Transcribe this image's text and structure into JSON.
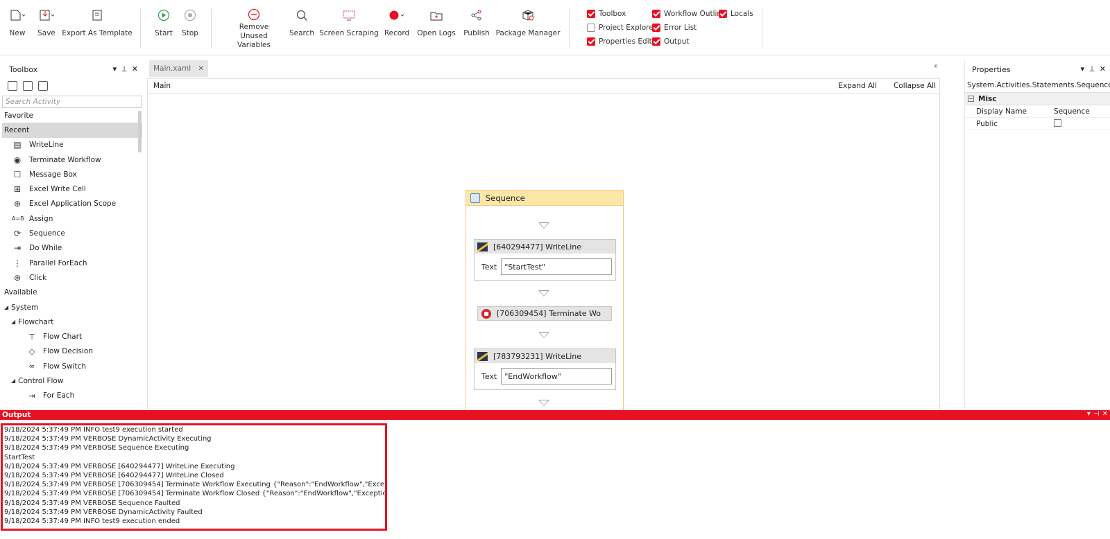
{
  "ribbon": {
    "buttons": [
      {
        "label": "New"
      },
      {
        "label": "Save"
      },
      {
        "label": "Export As Template"
      },
      {
        "label": "Start"
      },
      {
        "label": "Stop"
      },
      {
        "label": "Remove Unused\nVariables"
      },
      {
        "label": "Search"
      },
      {
        "label": "Screen Scraping"
      },
      {
        "label": "Record"
      },
      {
        "label": "Open Logs"
      },
      {
        "label": "Publish"
      },
      {
        "label": "Package Manager"
      }
    ],
    "checks": [
      {
        "label": "Toolbox",
        "checked": true
      },
      {
        "label": "Project Explorer",
        "checked": false
      },
      {
        "label": "Properties Editor",
        "checked": true
      },
      {
        "label": "Workflow Outline",
        "checked": true
      },
      {
        "label": "Error List",
        "checked": true
      },
      {
        "label": "Output",
        "checked": true
      },
      {
        "label": "Locals",
        "checked": true
      }
    ]
  },
  "toolbox": {
    "title": "Toolbox",
    "search_placeholder": "Search Activity",
    "favorite": "Favorite",
    "recent": "Recent",
    "recent_items": [
      "WriteLine",
      "Terminate Workflow",
      "Message Box",
      "Excel Write Cell",
      "Excel Application Scope",
      "Assign",
      "Sequence",
      "Do While",
      "Parallel ForEach",
      "Click"
    ],
    "available": "Available",
    "system": "System",
    "flowchart": "Flowchart",
    "flowchart_items": [
      "Flow Chart",
      "Flow Decision",
      "Flow Switch"
    ],
    "control_flow": "Control Flow",
    "control_flow_items": [
      "For Each"
    ]
  },
  "designer": {
    "tab": "Main.xaml",
    "breadcrumb": "Main",
    "expand_all": "Expand All",
    "collapse_all": "Collapse All",
    "sequence_title": "Sequence",
    "activities": {
      "writeline1_title": "[640294477] WriteLine",
      "writeline1_text_label": "Text",
      "writeline1_text": "\"StartTest\"",
      "terminate_title": "[706309454] Terminate Wo",
      "writeline2_title": "[783793231] WriteLine",
      "writeline2_text_label": "Text",
      "writeline2_text": "\"EndWorkflow\""
    }
  },
  "properties": {
    "title": "Properties",
    "type": "System.Activities.Statements.Sequence",
    "category": "Misc",
    "rows": [
      {
        "name": "Display Name",
        "value": "Sequence"
      },
      {
        "name": "Public",
        "value": ""
      }
    ]
  },
  "output": {
    "title": "Output",
    "lines": [
      "9/18/2024 5:37:49 PM INFO test9 execution started",
      "9/18/2024 5:37:49 PM VERBOSE DynamicActivity Executing",
      "9/18/2024 5:37:49 PM VERBOSE Sequence Executing",
      "StartTest",
      "9/18/2024 5:37:49 PM VERBOSE [640294477] WriteLine Executing",
      "9/18/2024 5:37:49 PM VERBOSE [640294477] WriteLine Closed",
      "9/18/2024 5:37:49 PM VERBOSE [706309454] Terminate Workflow Executing {\"Reason\":\"EndWorkflow\",\"Exception\":\"\"}",
      "9/18/2024 5:37:49 PM VERBOSE [706309454] Terminate Workflow Closed {\"Reason\":\"EndWorkflow\",\"Exception\":\"\"}",
      "9/18/2024 5:37:49 PM VERBOSE Sequence Faulted",
      "9/18/2024 5:37:49 PM VERBOSE DynamicActivity Faulted",
      "9/18/2024 5:37:49 PM INFO test9 execution ended"
    ]
  },
  "colors": {
    "accent": "#e81123",
    "sequence_header": "#fde7a8",
    "activity_header": "#e4e4e4"
  }
}
